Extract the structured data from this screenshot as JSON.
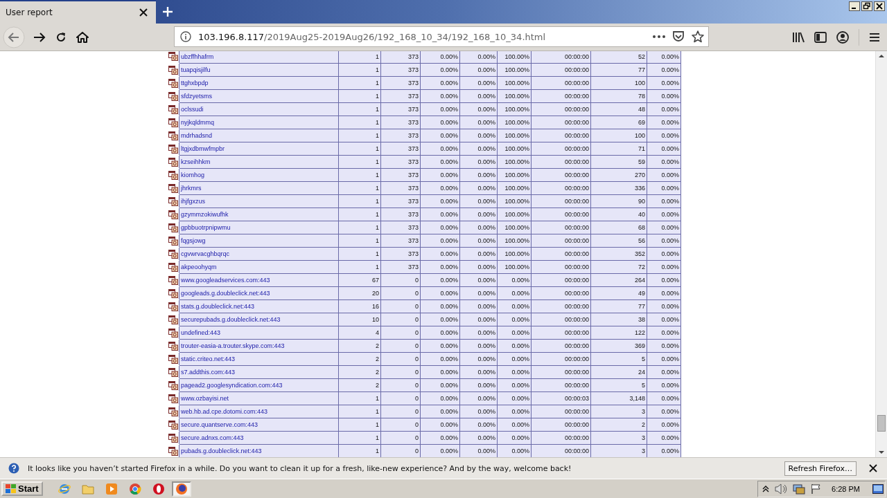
{
  "browser": {
    "tab_title": "User report",
    "url_host": "103.196.8.117",
    "url_path": "/2019Aug25-2019Aug26/192_168_10_34/192_168_10_34.html"
  },
  "table": {
    "rows": [
      {
        "name": "ubzffhhafrm",
        "cells": [
          "1",
          "373",
          "0.00%",
          "0.00%",
          "100.00%",
          "00:00:00",
          "52",
          "0.00%"
        ]
      },
      {
        "name": "tuapqisjilfu",
        "cells": [
          "1",
          "373",
          "0.00%",
          "0.00%",
          "100.00%",
          "00:00:00",
          "77",
          "0.00%"
        ]
      },
      {
        "name": "ttghxbpdp",
        "cells": [
          "1",
          "373",
          "0.00%",
          "0.00%",
          "100.00%",
          "00:00:00",
          "100",
          "0.00%"
        ]
      },
      {
        "name": "sfdzyetsms",
        "cells": [
          "1",
          "373",
          "0.00%",
          "0.00%",
          "100.00%",
          "00:00:00",
          "78",
          "0.00%"
        ]
      },
      {
        "name": "oclssudi",
        "cells": [
          "1",
          "373",
          "0.00%",
          "0.00%",
          "100.00%",
          "00:00:00",
          "48",
          "0.00%"
        ]
      },
      {
        "name": "nyjkqldmmq",
        "cells": [
          "1",
          "373",
          "0.00%",
          "0.00%",
          "100.00%",
          "00:00:00",
          "69",
          "0.00%"
        ]
      },
      {
        "name": "mdrhadsnd",
        "cells": [
          "1",
          "373",
          "0.00%",
          "0.00%",
          "100.00%",
          "00:00:00",
          "100",
          "0.00%"
        ]
      },
      {
        "name": "ltgjxdbmwfmpbr",
        "cells": [
          "1",
          "373",
          "0.00%",
          "0.00%",
          "100.00%",
          "00:00:00",
          "71",
          "0.00%"
        ]
      },
      {
        "name": "kzseihhkm",
        "cells": [
          "1",
          "373",
          "0.00%",
          "0.00%",
          "100.00%",
          "00:00:00",
          "59",
          "0.00%"
        ]
      },
      {
        "name": "kiomhog",
        "cells": [
          "1",
          "373",
          "0.00%",
          "0.00%",
          "100.00%",
          "00:00:00",
          "270",
          "0.00%"
        ]
      },
      {
        "name": "jhrkmrs",
        "cells": [
          "1",
          "373",
          "0.00%",
          "0.00%",
          "100.00%",
          "00:00:00",
          "336",
          "0.00%"
        ]
      },
      {
        "name": "ihjfgxzus",
        "cells": [
          "1",
          "373",
          "0.00%",
          "0.00%",
          "100.00%",
          "00:00:00",
          "90",
          "0.00%"
        ]
      },
      {
        "name": "gzymmzokiwufhk",
        "cells": [
          "1",
          "373",
          "0.00%",
          "0.00%",
          "100.00%",
          "00:00:00",
          "40",
          "0.00%"
        ]
      },
      {
        "name": "gpbbuotrpnipwmu",
        "cells": [
          "1",
          "373",
          "0.00%",
          "0.00%",
          "100.00%",
          "00:00:00",
          "68",
          "0.00%"
        ]
      },
      {
        "name": "fqgsjowg",
        "cells": [
          "1",
          "373",
          "0.00%",
          "0.00%",
          "100.00%",
          "00:00:00",
          "56",
          "0.00%"
        ]
      },
      {
        "name": "cgvwrvacghbqrqc",
        "cells": [
          "1",
          "373",
          "0.00%",
          "0.00%",
          "100.00%",
          "00:00:00",
          "352",
          "0.00%"
        ]
      },
      {
        "name": "akpeoohyqm",
        "cells": [
          "1",
          "373",
          "0.00%",
          "0.00%",
          "100.00%",
          "00:00:00",
          "72",
          "0.00%"
        ]
      },
      {
        "name": "www.googleadservices.com:443",
        "cells": [
          "67",
          "0",
          "0.00%",
          "0.00%",
          "0.00%",
          "00:00:00",
          "264",
          "0.00%"
        ]
      },
      {
        "name": "googleads.g.doubleclick.net:443",
        "cells": [
          "20",
          "0",
          "0.00%",
          "0.00%",
          "0.00%",
          "00:00:00",
          "49",
          "0.00%"
        ]
      },
      {
        "name": "stats.g.doubleclick.net:443",
        "cells": [
          "16",
          "0",
          "0.00%",
          "0.00%",
          "0.00%",
          "00:00:00",
          "77",
          "0.00%"
        ]
      },
      {
        "name": "securepubads.g.doubleclick.net:443",
        "cells": [
          "10",
          "0",
          "0.00%",
          "0.00%",
          "0.00%",
          "00:00:00",
          "38",
          "0.00%"
        ]
      },
      {
        "name": "undefined:443",
        "cells": [
          "4",
          "0",
          "0.00%",
          "0.00%",
          "0.00%",
          "00:00:00",
          "122",
          "0.00%"
        ]
      },
      {
        "name": "trouter-easia-a.trouter.skype.com:443",
        "cells": [
          "2",
          "0",
          "0.00%",
          "0.00%",
          "0.00%",
          "00:00:00",
          "369",
          "0.00%"
        ]
      },
      {
        "name": "static.criteo.net:443",
        "cells": [
          "2",
          "0",
          "0.00%",
          "0.00%",
          "0.00%",
          "00:00:00",
          "5",
          "0.00%"
        ]
      },
      {
        "name": "s7.addthis.com:443",
        "cells": [
          "2",
          "0",
          "0.00%",
          "0.00%",
          "0.00%",
          "00:00:00",
          "24",
          "0.00%"
        ]
      },
      {
        "name": "pagead2.googlesyndication.com:443",
        "cells": [
          "2",
          "0",
          "0.00%",
          "0.00%",
          "0.00%",
          "00:00:00",
          "5",
          "0.00%"
        ]
      },
      {
        "name": "www.ozbayisi.net",
        "cells": [
          "1",
          "0",
          "0.00%",
          "0.00%",
          "0.00%",
          "00:00:03",
          "3,148",
          "0.00%"
        ]
      },
      {
        "name": "web.hb.ad.cpe.dotomi.com:443",
        "cells": [
          "1",
          "0",
          "0.00%",
          "0.00%",
          "0.00%",
          "00:00:00",
          "3",
          "0.00%"
        ]
      },
      {
        "name": "secure.quantserve.com:443",
        "cells": [
          "1",
          "0",
          "0.00%",
          "0.00%",
          "0.00%",
          "00:00:00",
          "2",
          "0.00%"
        ]
      },
      {
        "name": "secure.adnxs.com:443",
        "cells": [
          "1",
          "0",
          "0.00%",
          "0.00%",
          "0.00%",
          "00:00:00",
          "3",
          "0.00%"
        ]
      },
      {
        "name": "pubads.g.doubleclick.net:443",
        "cells": [
          "1",
          "0",
          "0.00%",
          "0.00%",
          "0.00%",
          "00:00:00",
          "3",
          "0.00%"
        ]
      }
    ]
  },
  "notification": {
    "message": "It looks like you haven’t started Firefox in a while. Do you want to clean it up for a fresh, like-new experience? And by the way, welcome back!",
    "button": "Refresh Firefox…"
  },
  "taskbar": {
    "start": "Start",
    "clock": "6:28 PM"
  }
}
